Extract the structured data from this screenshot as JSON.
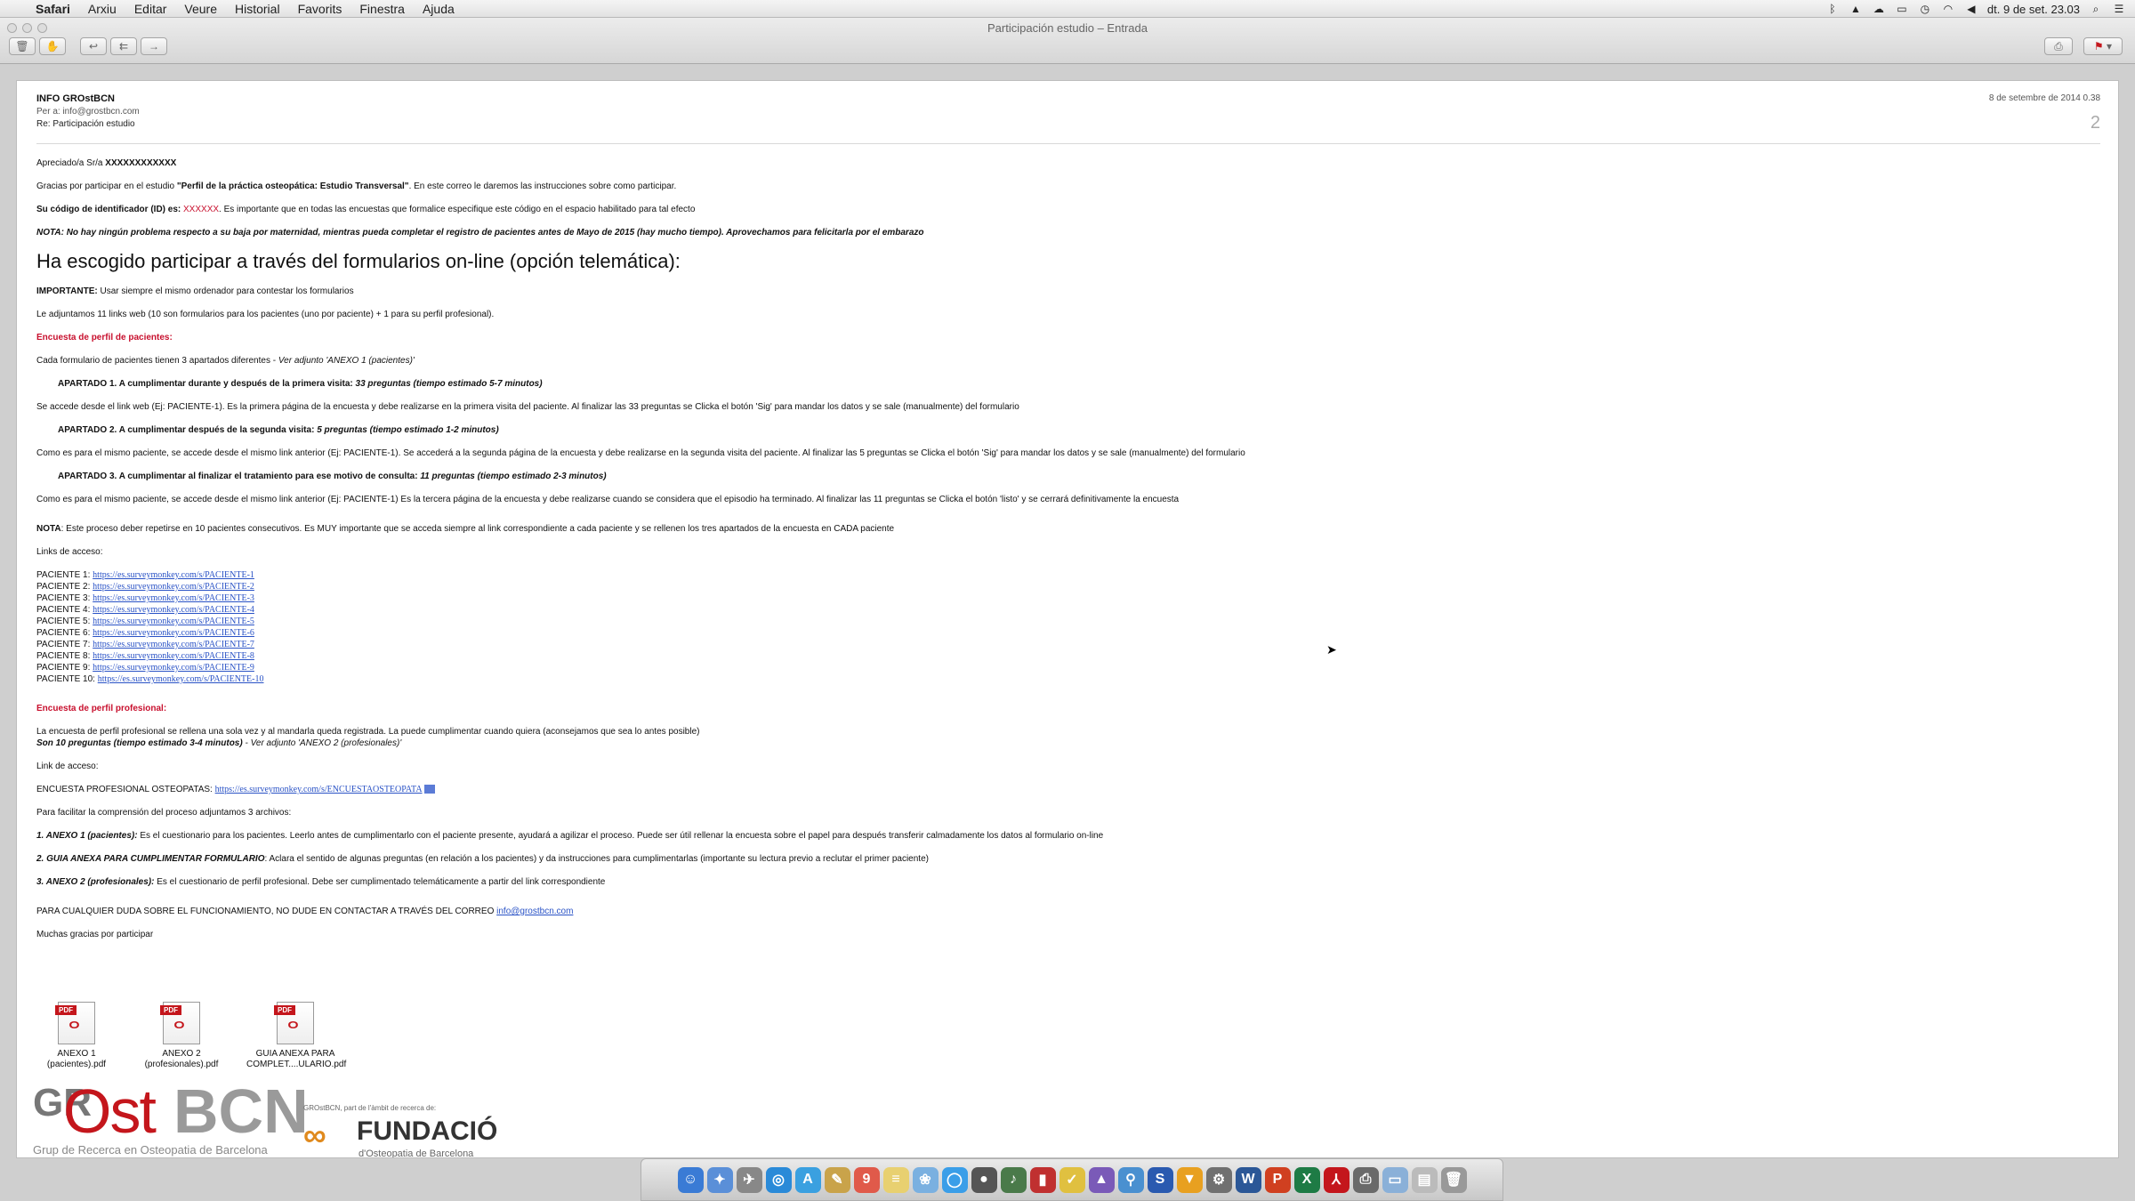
{
  "menubar": {
    "apple": "",
    "items": [
      "Safari",
      "Arxiu",
      "Editar",
      "Veure",
      "Historial",
      "Favorits",
      "Finestra",
      "Ajuda"
    ],
    "clock": "dt. 9 de set. 23.03"
  },
  "window": {
    "title": "Participación estudio – Entrada"
  },
  "message": {
    "from": "INFO GROstBCN",
    "to": "Per a:  info@grostbcn.com",
    "subject": "Re: Participación estudio",
    "date": "8 de setembre de 2014 0.38",
    "thread_count": "2"
  },
  "body": {
    "greeting_prefix": "Apreciado/a Sr/a",
    "greeting_name": "XXXXXXXXXXXX",
    "intro_a": "Gracias por participar en el estudio ",
    "intro_study": "\"Perfil de la práctica osteopática: Estudio Transversal\"",
    "intro_b": ". En este correo le daremos las instrucciones sobre como participar.",
    "id_label": "Su código de identificador (ID) es: ",
    "id_value": "XXXXXX",
    "id_text": ". Es importante que en todas las encuestas que formalice especifique este código en el espacio habilitado para tal efecto",
    "nota_maternidad": "NOTA: No hay ningún problema respecto a su baja por maternidad, mientras pueda completar el registro de pacientes antes de Mayo de 2015 (hay mucho tiempo). Aprovechamos para felicitarla por el embarazo",
    "heading": "Ha escogido participar a través del formularios on-line (opción telemática):",
    "importante_label": "IMPORTANTE:",
    "importante_text": " Usar siempre el mismo ordenador para contestar los formularios",
    "adjuntamos": "Le adjuntamos 11 links web (10 son formularios para los pacientes (uno por paciente) + 1 para su perfil profesional).",
    "sec_pacientes": "Encuesta de perfil de pacientes:",
    "cada_formulario_a": "Cada formulario de pacientes tienen 3 apartados diferentes - ",
    "cada_formulario_b": "Ver adjunto 'ANEXO 1 (pacientes)'",
    "ap1_title": "APARTADO 1. A cumplimentar durante y después de la primera visita: ",
    "ap1_time": "33 preguntas (tiempo estimado 5-7 minutos)",
    "ap1_text": "Se accede desde el link web (Ej: PACIENTE-1). Es la primera página de la encuesta y debe realizarse en la primera visita del paciente. Al finalizar las 33 preguntas se Clicka el botón 'Sig' para mandar los datos y se sale (manualmente) del formulario",
    "ap2_title": "APARTADO 2. A cumplimentar después de la segunda visita: ",
    "ap2_time": "5 preguntas (tiempo estimado 1-2 minutos)",
    "ap2_text": "Como es para el mismo paciente, se accede desde el mismo link anterior (Ej: PACIENTE-1). Se accederá a la segunda página de la encuesta y debe realizarse en la segunda visita del paciente. Al finalizar las 5 preguntas se Clicka el botón 'Sig' para mandar los datos y se sale (manualmente) del formulario",
    "ap3_title": "APARTADO 3. A cumplimentar al finalizar el tratamiento para ese motivo de consulta: ",
    "ap3_time": "11 preguntas (tiempo estimado 2-3 minutos)",
    "ap3_text": "Como es para el mismo paciente, se accede desde el mismo link anterior (Ej: PACIENTE-1) Es la tercera página de la encuesta y debe realizarse cuando se considera que el episodio ha terminado. Al finalizar las 11 preguntas se Clicka el botón 'listo' y se cerrará definitivamente la encuesta",
    "nota2_label": "NOTA",
    "nota2_text": ": Este proceso deber repetirse en 10 pacientes consecutivos. Es MUY importante que se acceda siempre al link correspondiente a cada paciente y se rellenen los tres apartados de la encuesta en CADA paciente",
    "links_label": "Links de acceso:",
    "patient_links": [
      {
        "label": "PACIENTE 1: ",
        "url": "https://es.surveymonkey.com/s/PACIENTE-1"
      },
      {
        "label": "PACIENTE 2: ",
        "url": "https://es.surveymonkey.com/s/PACIENTE-2"
      },
      {
        "label": "PACIENTE 3: ",
        "url": "https://es.surveymonkey.com/s/PACIENTE-3"
      },
      {
        "label": "PACIENTE 4: ",
        "url": "https://es.surveymonkey.com/s/PACIENTE-4"
      },
      {
        "label": "PACIENTE 5: ",
        "url": "https://es.surveymonkey.com/s/PACIENTE-5"
      },
      {
        "label": "PACIENTE 6: ",
        "url": "https://es.surveymonkey.com/s/PACIENTE-6"
      },
      {
        "label": "PACIENTE 7: ",
        "url": "https://es.surveymonkey.com/s/PACIENTE-7"
      },
      {
        "label": "PACIENTE 8: ",
        "url": "https://es.surveymonkey.com/s/PACIENTE-8"
      },
      {
        "label": "PACIENTE 9: ",
        "url": "https://es.surveymonkey.com/s/PACIENTE-9"
      },
      {
        "label": "PACIENTE 10: ",
        "url": "https://es.surveymonkey.com/s/PACIENTE-10"
      }
    ],
    "sec_profesional": "Encuesta de perfil profesional:",
    "prof_text": "La encuesta de perfil profesional se rellena una sola vez y al mandarla queda registrada. La puede cumplimentar cuando quiera (aconsejamos que sea lo antes posible)",
    "prof_time": "Son 10 preguntas (tiempo estimado 3-4 minutos)",
    "prof_anexo": " - Ver adjunto 'ANEXO 2 (profesionales)'",
    "link_label": "Link de acceso:",
    "prof_link_label": "ENCUESTA PROFESIONAL OSTEOPATAS: ",
    "prof_link_url": "https://es.surveymonkey.com/s/ENCUESTAOSTEOPATA",
    "archivos_intro": "Para facilitar la comprensión del proceso adjuntamos 3 archivos:",
    "file1_label": "1. ANEXO 1 (pacientes):",
    "file1_text": " Es el cuestionario para los pacientes. Leerlo antes de cumplimentarlo con el paciente presente, ayudará a agilizar el proceso. Puede ser útil rellenar la encuesta sobre el papel para después transferir calmadamente los datos al formulario on-line",
    "file2_label": "2. GUIA ANEXA PARA CUMPLIMENTAR FORMULARIO",
    "file2_text": ": Aclara el sentido de algunas preguntas (en relación a los pacientes) y da instrucciones para cumplimentarlas (importante su lectura previo a reclutar el primer paciente)",
    "file3_label": "3. ANEXO 2 (profesionales):",
    "file3_text": " Es el cuestionario de perfil profesional. Debe ser cumplimentado telemáticamente a partir del link correspondiente",
    "contact_text": "PARA CUALQUIER DUDA SOBRE EL FUNCIONAMIENTO, NO DUDE EN CONTACTAR A TRAVÉS DEL CORREO ",
    "contact_email": "info@grostbcn.com",
    "thanks": "Muchas gracias por participar"
  },
  "attachments": [
    {
      "line1": "ANEXO 1",
      "line2": "(pacientes).pdf"
    },
    {
      "line1": "ANEXO 2",
      "line2": "(profesionales).pdf"
    },
    {
      "line1": "GUIA ANEXA PARA",
      "line2": "COMPLET....ULARIO.pdf"
    }
  ],
  "pdf_badge": "PDF",
  "logos": {
    "gr": "GR",
    "ost": "Ost",
    "bcn": "BCN",
    "grost_tagline": "Grup de Recerca en Osteopatia de Barcelona",
    "fund_tagline": "GROstBCN, part de l'àmbit de recerca de:",
    "fund_name": "FUNDACIÓ",
    "fund_sub": "d'Osteopatia de Barcelona"
  },
  "accent_color": "#2952c6",
  "alert_color": "#c8102e"
}
